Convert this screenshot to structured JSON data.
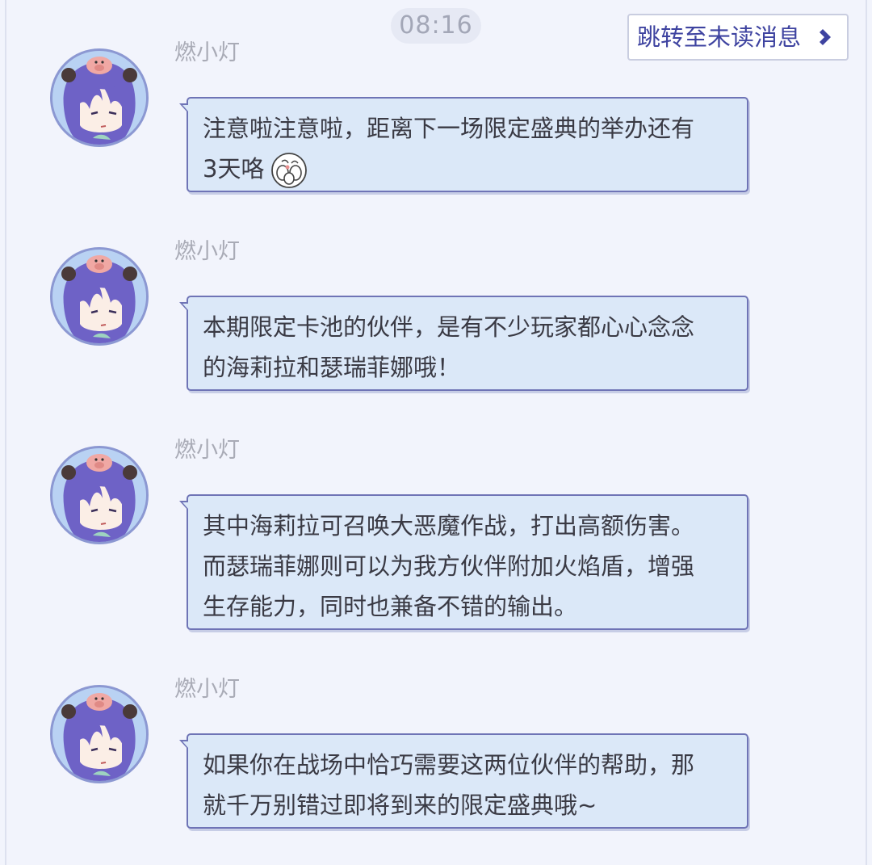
{
  "header": {
    "time": "08:16",
    "jump_label": "跳转至未读消息",
    "jump_icon": "chevron-right-icon"
  },
  "colors": {
    "bubble_bg": "#dbe8f8",
    "bubble_border": "#6f74b6",
    "accent": "#3e43a0",
    "avatar_hair": "#6e62c6"
  },
  "messages": [
    {
      "sender": "燃小灯",
      "avatar_icon": "purple-hair-character-avatar",
      "lines": [
        "注意啦注意啦，距离下一场限定盛典的举办还有",
        "3天咯"
      ],
      "emoji_icon": "egg-chick-emoji-icon"
    },
    {
      "sender": "燃小灯",
      "avatar_icon": "purple-hair-character-avatar",
      "lines": [
        "本期限定卡池的伙伴，是有不少玩家都心心念念",
        "的海莉拉和瑟瑞菲娜哦！"
      ]
    },
    {
      "sender": "燃小灯",
      "avatar_icon": "purple-hair-character-avatar",
      "lines": [
        "其中海莉拉可召唤大恶魔作战，打出高额伤害。",
        "而瑟瑞菲娜则可以为我方伙伴附加火焰盾，增强",
        "生存能力，同时也兼备不错的输出。"
      ]
    },
    {
      "sender": "燃小灯",
      "avatar_icon": "purple-hair-character-avatar",
      "lines": [
        "如果你在战场中恰巧需要这两位伙伴的帮助，那",
        "就千万别错过即将到来的限定盛典哦~"
      ]
    }
  ]
}
